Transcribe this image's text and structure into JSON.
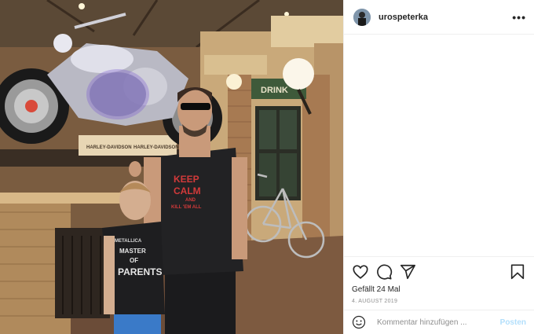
{
  "post": {
    "username": "urospeterka",
    "more_label": "•••",
    "likes_text": "Gefällt 24 Mal",
    "date_text": "4. AUGUST 2019"
  },
  "photo": {
    "sign_text": "DRINK",
    "box_text_1": "HARLEY-DAVIDSON",
    "box_text_2": "HARLEY-DAVIDSON",
    "shirt_man_line1": "KEEP",
    "shirt_man_line2": "CALM",
    "shirt_man_line3": "AND",
    "shirt_man_line4": "KILL 'EM ALL",
    "shirt_boy_band": "METALLICA",
    "shirt_boy_line1": "MASTER",
    "shirt_boy_line2": "OF",
    "shirt_boy_line3": "PARENTS"
  },
  "comment": {
    "placeholder": "Kommentar hinzufügen ...",
    "post_label": "Posten"
  },
  "icons": {
    "like": "heart-icon",
    "comment": "comment-icon",
    "share": "share-icon",
    "save": "bookmark-icon",
    "emoji": "emoji-icon"
  },
  "colors": {
    "post_button": "#b2dffc",
    "text": "#262626",
    "muted": "#8e8e8e"
  }
}
